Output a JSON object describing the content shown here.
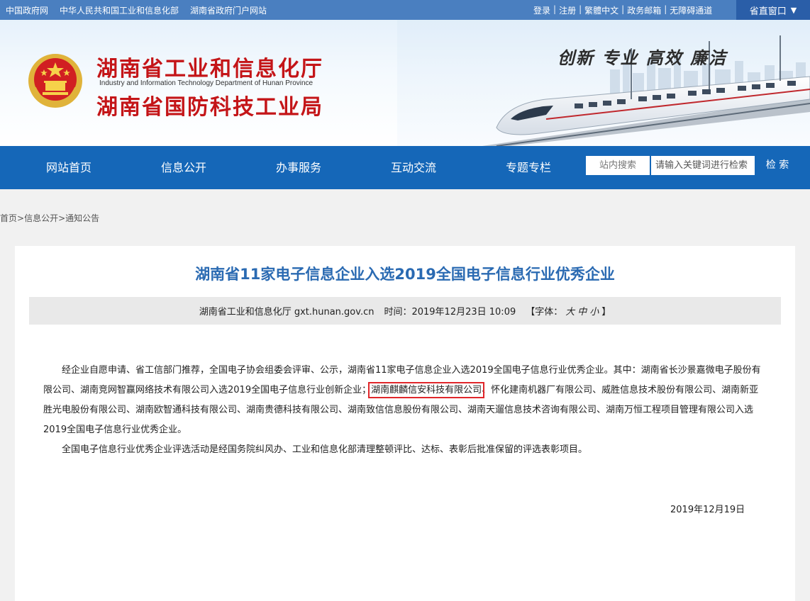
{
  "topbar": {
    "links_left": [
      "中国政府网",
      "中华人民共和国工业和信息化部",
      "湖南省政府门户网站"
    ],
    "links_right": [
      "登录",
      "注册",
      "繁體中文",
      "政务邮箱",
      "无障碍通道"
    ],
    "portal_button": "省直窗口",
    "portal_arrow": "▼"
  },
  "header": {
    "title_cn_1": "湖南省工业和信息化厅",
    "title_en": "Industry and Information Technology Department of Hunan Province",
    "title_cn_2": "湖南省国防科技工业局",
    "slogan": "创新 专业 高效 廉洁"
  },
  "nav": {
    "items": [
      "网站首页",
      "信息公开",
      "办事服务",
      "互动交流",
      "专题专栏"
    ],
    "search_label": "站内搜索",
    "search_placeholder": "请输入关键词进行检索",
    "search_button": "检 索"
  },
  "breadcrumb": {
    "items": [
      "首页",
      "信息公开",
      "通知公告"
    ],
    "separator": ">"
  },
  "article": {
    "title": "湖南省11家电子信息企业入选2019全国电子信息行业优秀企业",
    "source": "湖南省工业和信息化厅 gxt.hunan.gov.cn",
    "time": "时间：2019年12月23日 10:09",
    "font_label": "【字体：",
    "font_sizes": [
      "大",
      "中",
      "小"
    ],
    "font_close": "】",
    "p1_a": "经企业自愿申请、省工信部门推荐，全国电子协会组委会评审、公示，湖南省11家电子信息企业入选2019全国电子信息行业优秀企业。其中：湖南省长沙景嘉微电子股份有限公司、湖南竞网智赢网络技术有限公司入选2019全国电子信息行业创新企业；",
    "p1_highlight": "湖南麒麟信安科技有限公司",
    "p1_b": "、怀化建南机器厂有限公司、威胜信息技术股份有限公司、湖南新亚胜光电股份有限公司、湖南欧智通科技有限公司、湖南贵德科技有限公司、湖南致信信息股份有限公司、湖南天遛信息技术咨询有限公司、湖南万恒工程项目管理有限公司入选2019全国电子信息行业优秀企业。",
    "p2": "全国电子信息行业优秀企业评选活动是经国务院纠风办、工业和信息化部清理整顿评比、达标、表彰后批准保留的评选表彰项目。",
    "sign_date": "2019年12月19日"
  },
  "colors": {
    "topbar": "#4a7fc0",
    "nav": "#1567b8",
    "title_red": "#c41518",
    "article_title": "#2a6ab2",
    "highlight_box": "#e0262a"
  }
}
